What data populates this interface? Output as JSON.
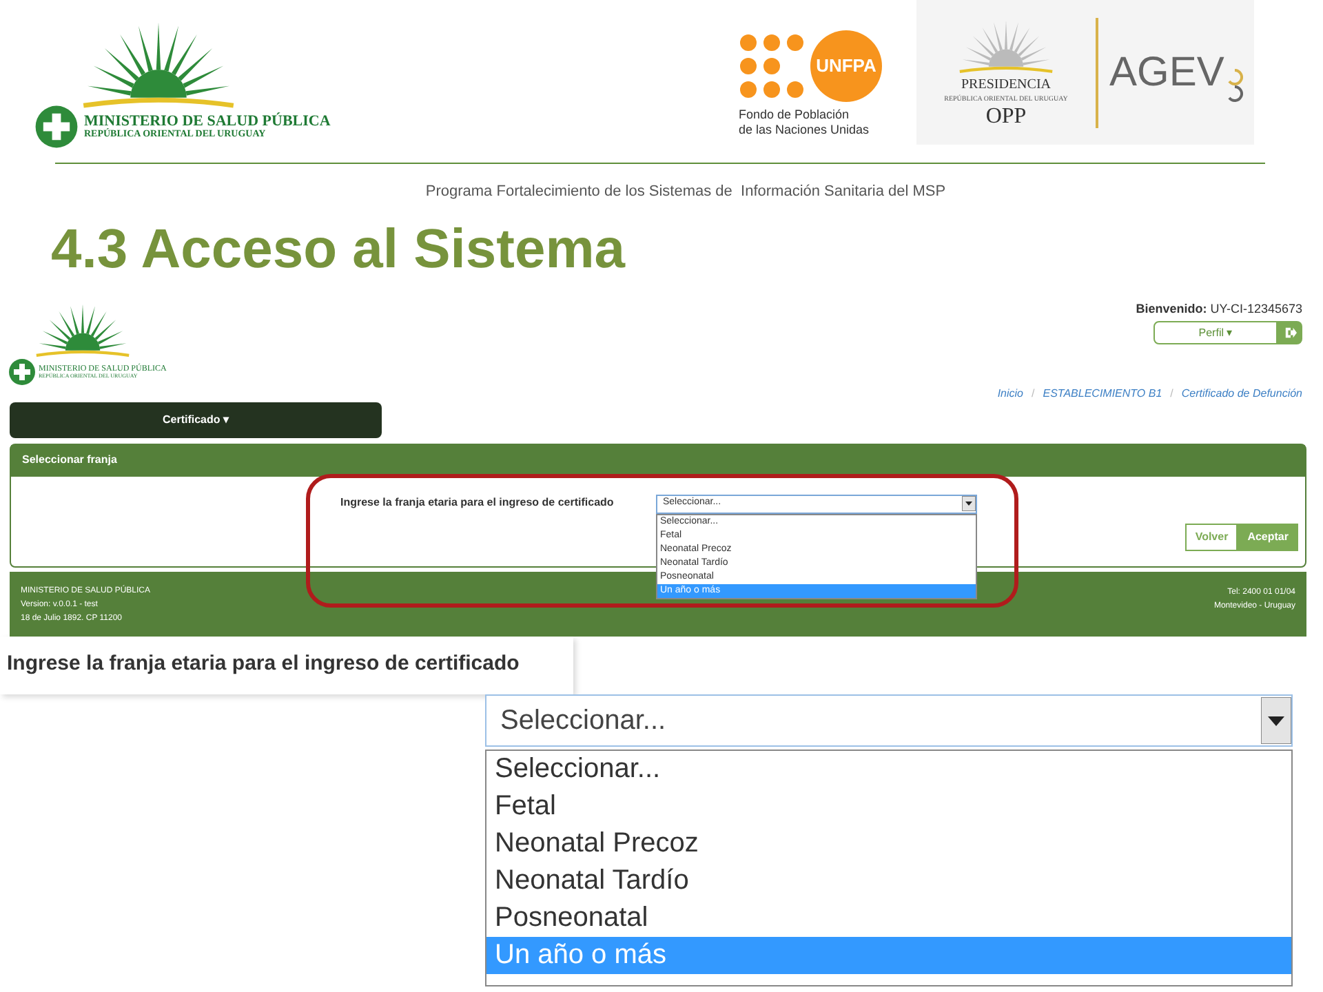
{
  "logos": {
    "ministry": [
      "MINISTERIO DE SALUD PÚBLICA",
      "REPÚBLICA ORIENTAL DEL URUGUAY"
    ],
    "unfpa": {
      "mark": "UNFPA",
      "caption": [
        "Fondo de Población",
        "de las Naciones Unidas"
      ]
    },
    "opp": [
      "PRESIDENCIA",
      "REPÚBLICA ORIENTAL DEL URUGUAY",
      "OPP"
    ],
    "agev": "AGEV"
  },
  "slide": {
    "subtitle": "Programa Fortalecimiento de los Sistemas de  Información Sanitaria del MSP",
    "title": "4.3 Acceso al Sistema"
  },
  "app": {
    "logo": [
      "MINISTERIO DE SALUD PÚBLICA",
      "REPÚBLICA ORIENTAL DEL URUGUAY"
    ],
    "welcome": "**Bienvenido:** UY-CI-12345673",
    "profile": "Perfil ▾",
    "breadcrumb": [
      {
        "kind": "link",
        "text": "Inicio"
      },
      {
        "kind": "separator",
        "text": "/"
      },
      {
        "kind": "link",
        "text": "ESTABLECIMIENTO B1"
      },
      {
        "kind": "separator",
        "text": "/"
      },
      {
        "kind": "link",
        "text": "Certificado de Defunción"
      }
    ],
    "nav_menu": "Certificado ▾",
    "panel_title": "Seleccionar franja",
    "field_label": "Ingrese la franja etaria para el ingreso de certificado",
    "select": {
      "value": "Seleccionar...",
      "options": [
        {
          "label": "Seleccionar...",
          "highlighted": false
        },
        {
          "label": "Fetal",
          "highlighted": false
        },
        {
          "label": "Neonatal Precoz",
          "highlighted": false
        },
        {
          "label": "Neonatal Tardío",
          "highlighted": false
        },
        {
          "label": "Posneonatal",
          "highlighted": false
        },
        {
          "label": "Un año o más",
          "highlighted": true
        }
      ]
    },
    "buttons": [
      {
        "label": "Volver",
        "kind": "outline"
      },
      {
        "label": "Aceptar",
        "kind": "filled"
      }
    ],
    "footer_left": [
      "MINISTERIO DE SALUD PÚBLICA",
      "Version: v.0.0.1 - test",
      "18 de Julio 1892. CP 11200"
    ],
    "footer_right": [
      "Tel: 2400 01 01/04",
      "Montevideo - Uruguay"
    ]
  },
  "zoom": {
    "field_label": "Ingrese la franja etaria para el ingreso de certificado",
    "select": {
      "value": "Seleccionar...",
      "options": [
        {
          "label": "Seleccionar...",
          "highlighted": false
        },
        {
          "label": "Fetal",
          "highlighted": false
        },
        {
          "label": "Neonatal Precoz",
          "highlighted": false
        },
        {
          "label": "Neonatal Tardío",
          "highlighted": false
        },
        {
          "label": "Posneonatal",
          "highlighted": false
        },
        {
          "label": "Un año o más",
          "highlighted": true
        }
      ]
    }
  }
}
